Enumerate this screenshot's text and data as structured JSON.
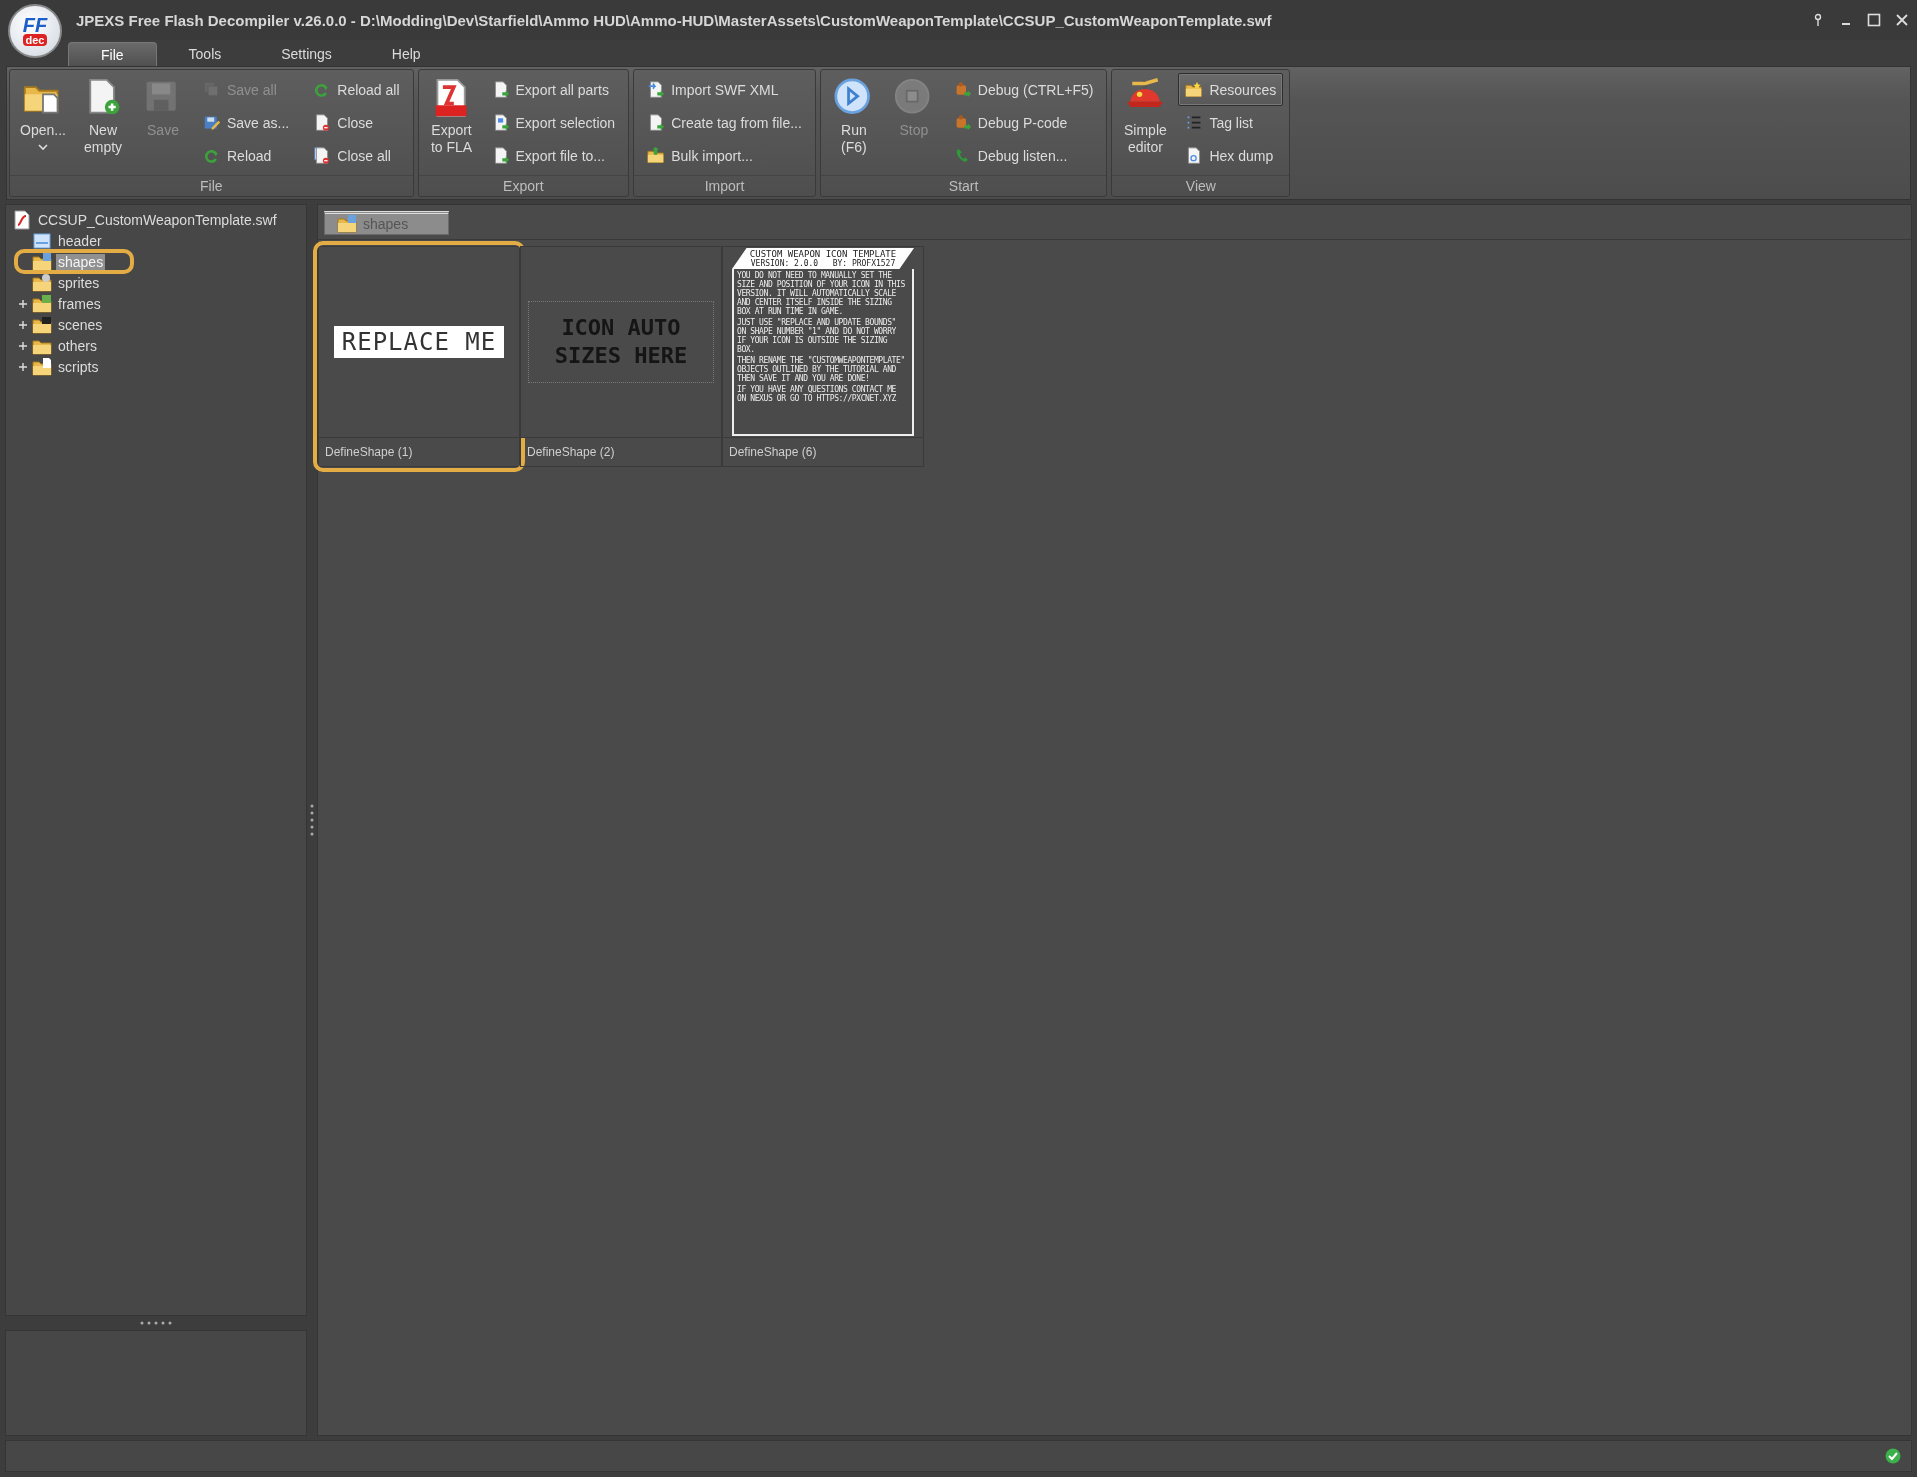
{
  "window": {
    "logo": {
      "top": "FF",
      "bottom": "dec"
    },
    "title": "JPEXS Free Flash Decompiler v.26.0.0 - D:\\Modding\\Dev\\Starfield\\Ammo HUD\\Ammo-HUD\\MasterAssets\\CustomWeaponTemplate\\CCSUP_CustomWeaponTemplate.swf"
  },
  "menu_tabs": [
    {
      "label": "File",
      "selected": true
    },
    {
      "label": "Tools",
      "selected": false
    },
    {
      "label": "Settings",
      "selected": false
    },
    {
      "label": "Help",
      "selected": false
    }
  ],
  "ribbon": [
    {
      "title": "File",
      "items": [
        {
          "kind": "large-menu",
          "label": "Open...",
          "disabled": false
        },
        {
          "kind": "large",
          "label": "New\nempty",
          "disabled": false
        },
        {
          "kind": "large",
          "label": "Save",
          "disabled": true
        },
        {
          "kind": "small",
          "label": "Save all",
          "disabled": true
        },
        {
          "kind": "small",
          "label": "Save as...",
          "disabled": false
        },
        {
          "kind": "small",
          "label": "Reload",
          "disabled": false
        },
        {
          "kind": "small",
          "label": "Reload all",
          "disabled": false
        },
        {
          "kind": "small",
          "label": "Close",
          "disabled": false
        },
        {
          "kind": "small",
          "label": "Close all",
          "disabled": false
        }
      ]
    },
    {
      "title": "Export",
      "items": [
        {
          "kind": "large",
          "label": "Export\nto FLA",
          "disabled": false
        },
        {
          "kind": "small",
          "label": "Export all parts",
          "disabled": false
        },
        {
          "kind": "small",
          "label": "Export selection",
          "disabled": false
        },
        {
          "kind": "small",
          "label": "Export file to...",
          "disabled": false
        }
      ]
    },
    {
      "title": "Import",
      "items": [
        {
          "kind": "small",
          "label": "Import SWF XML",
          "disabled": false
        },
        {
          "kind": "small",
          "label": "Create tag from file...",
          "disabled": false
        },
        {
          "kind": "small",
          "label": "Bulk import...",
          "disabled": false
        }
      ]
    },
    {
      "title": "Start",
      "items": [
        {
          "kind": "large",
          "label": "Run\n(F6)",
          "disabled": false
        },
        {
          "kind": "large",
          "label": "Stop",
          "disabled": true
        },
        {
          "kind": "small",
          "label": "Debug (CTRL+F5)",
          "disabled": false
        },
        {
          "kind": "small",
          "label": "Debug P-code",
          "disabled": false
        },
        {
          "kind": "small",
          "label": "Debug listen...",
          "disabled": false
        }
      ]
    },
    {
      "title": "View",
      "items": [
        {
          "kind": "large",
          "label": "Simple\neditor",
          "disabled": false,
          "selected": false
        },
        {
          "kind": "small",
          "label": "Resources",
          "disabled": false,
          "selected": true
        },
        {
          "kind": "small",
          "label": "Tag list",
          "disabled": false,
          "selected": false
        },
        {
          "kind": "small",
          "label": "Hex dump",
          "disabled": false,
          "selected": false
        }
      ]
    }
  ],
  "tree": {
    "label": "CCSUP_CustomWeaponTemplate.swf",
    "children": [
      {
        "label": "header",
        "selected": false,
        "expandable": false,
        "highlighted": false
      },
      {
        "label": "shapes",
        "selected": true,
        "expandable": false,
        "highlighted": true
      },
      {
        "label": "sprites",
        "selected": false,
        "expandable": false,
        "highlighted": false
      },
      {
        "label": "frames",
        "selected": false,
        "expandable": true,
        "highlighted": false
      },
      {
        "label": "scenes",
        "selected": false,
        "expandable": true,
        "highlighted": false
      },
      {
        "label": "others",
        "selected": false,
        "expandable": true,
        "highlighted": false
      },
      {
        "label": "scripts",
        "selected": false,
        "expandable": true,
        "highlighted": false
      }
    ]
  },
  "content_tab": {
    "label": "shapes"
  },
  "shapes": [
    {
      "kind": "banner",
      "caption": "DefineShape (1)",
      "highlighted": true,
      "text": "REPLACE ME"
    },
    {
      "kind": "sizing-box",
      "caption": "DefineShape (2)",
      "highlighted": false,
      "lines": [
        "ICON AUTO",
        "SIZES HERE"
      ]
    },
    {
      "kind": "instructions",
      "caption": "DefineShape (6)",
      "highlighted": false,
      "heading": "CUSTOM WEAPON ICON TEMPLATE",
      "subheading": "VERSION: 2.0.0   BY: PROFX1527",
      "paragraphs": [
        "YOU DO NOT NEED TO MANUALLY SET THE SIZE AND POSITION OF YOUR ICON IN THIS VERSION. IT WILL AUTOMATICALLY SCALE AND CENTER ITSELF INSIDE THE SIZING BOX AT RUN TIME IN GAME.",
        "JUST USE \"REPLACE AND UPDATE BOUNDS\" ON SHAPE NUMBER \"1\" AND DO NOT WORRY IF YOUR ICON IS OUTSIDE THE SIZING BOX.",
        "THEN RENAME THE \"CUSTOMWEAPONTEMPLATE\" OBJECTS OUTLINED BY THE TUTORIAL AND THEN SAVE IT AND YOU ARE DONE!",
        "IF YOU HAVE ANY QUESTIONS CONTACT ME ON NEXUS OR GO TO HTTPS://PXCNET.XYZ"
      ]
    }
  ]
}
